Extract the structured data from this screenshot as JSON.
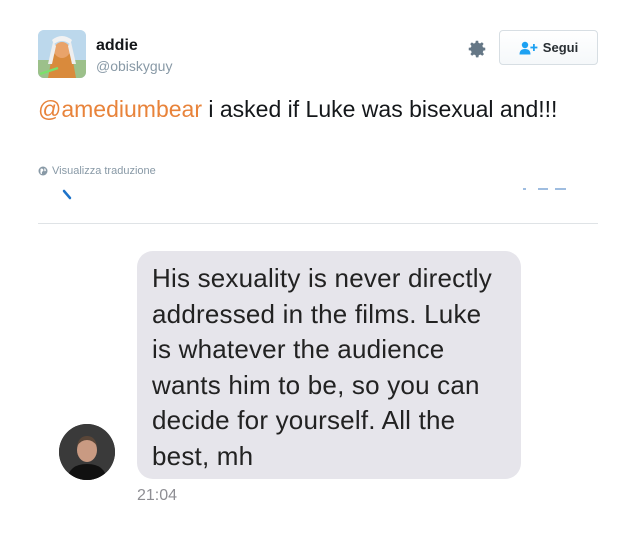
{
  "tweet": {
    "author": {
      "name": "addie",
      "handle": "@obiskyguy"
    },
    "follow_label": "Segui",
    "text": {
      "mention": "@amediumbear",
      "body": " i asked if Luke was bisexual and!!!"
    },
    "translate_label": "Visualizza traduzione"
  },
  "message": {
    "text": "His sexuality is never directly addressed in the films. Luke is whatever the audience wants him to be, so you can decide for yourself. All the best, mh",
    "time": "21:04"
  },
  "colors": {
    "mention": "#e8833a",
    "follow_icon": "#1da1f2",
    "bubble": "#e6e5eb",
    "muted": "#8899a6"
  },
  "icons": {
    "settings": "gear-icon",
    "follow": "add-person-icon",
    "translate": "globe-icon"
  }
}
